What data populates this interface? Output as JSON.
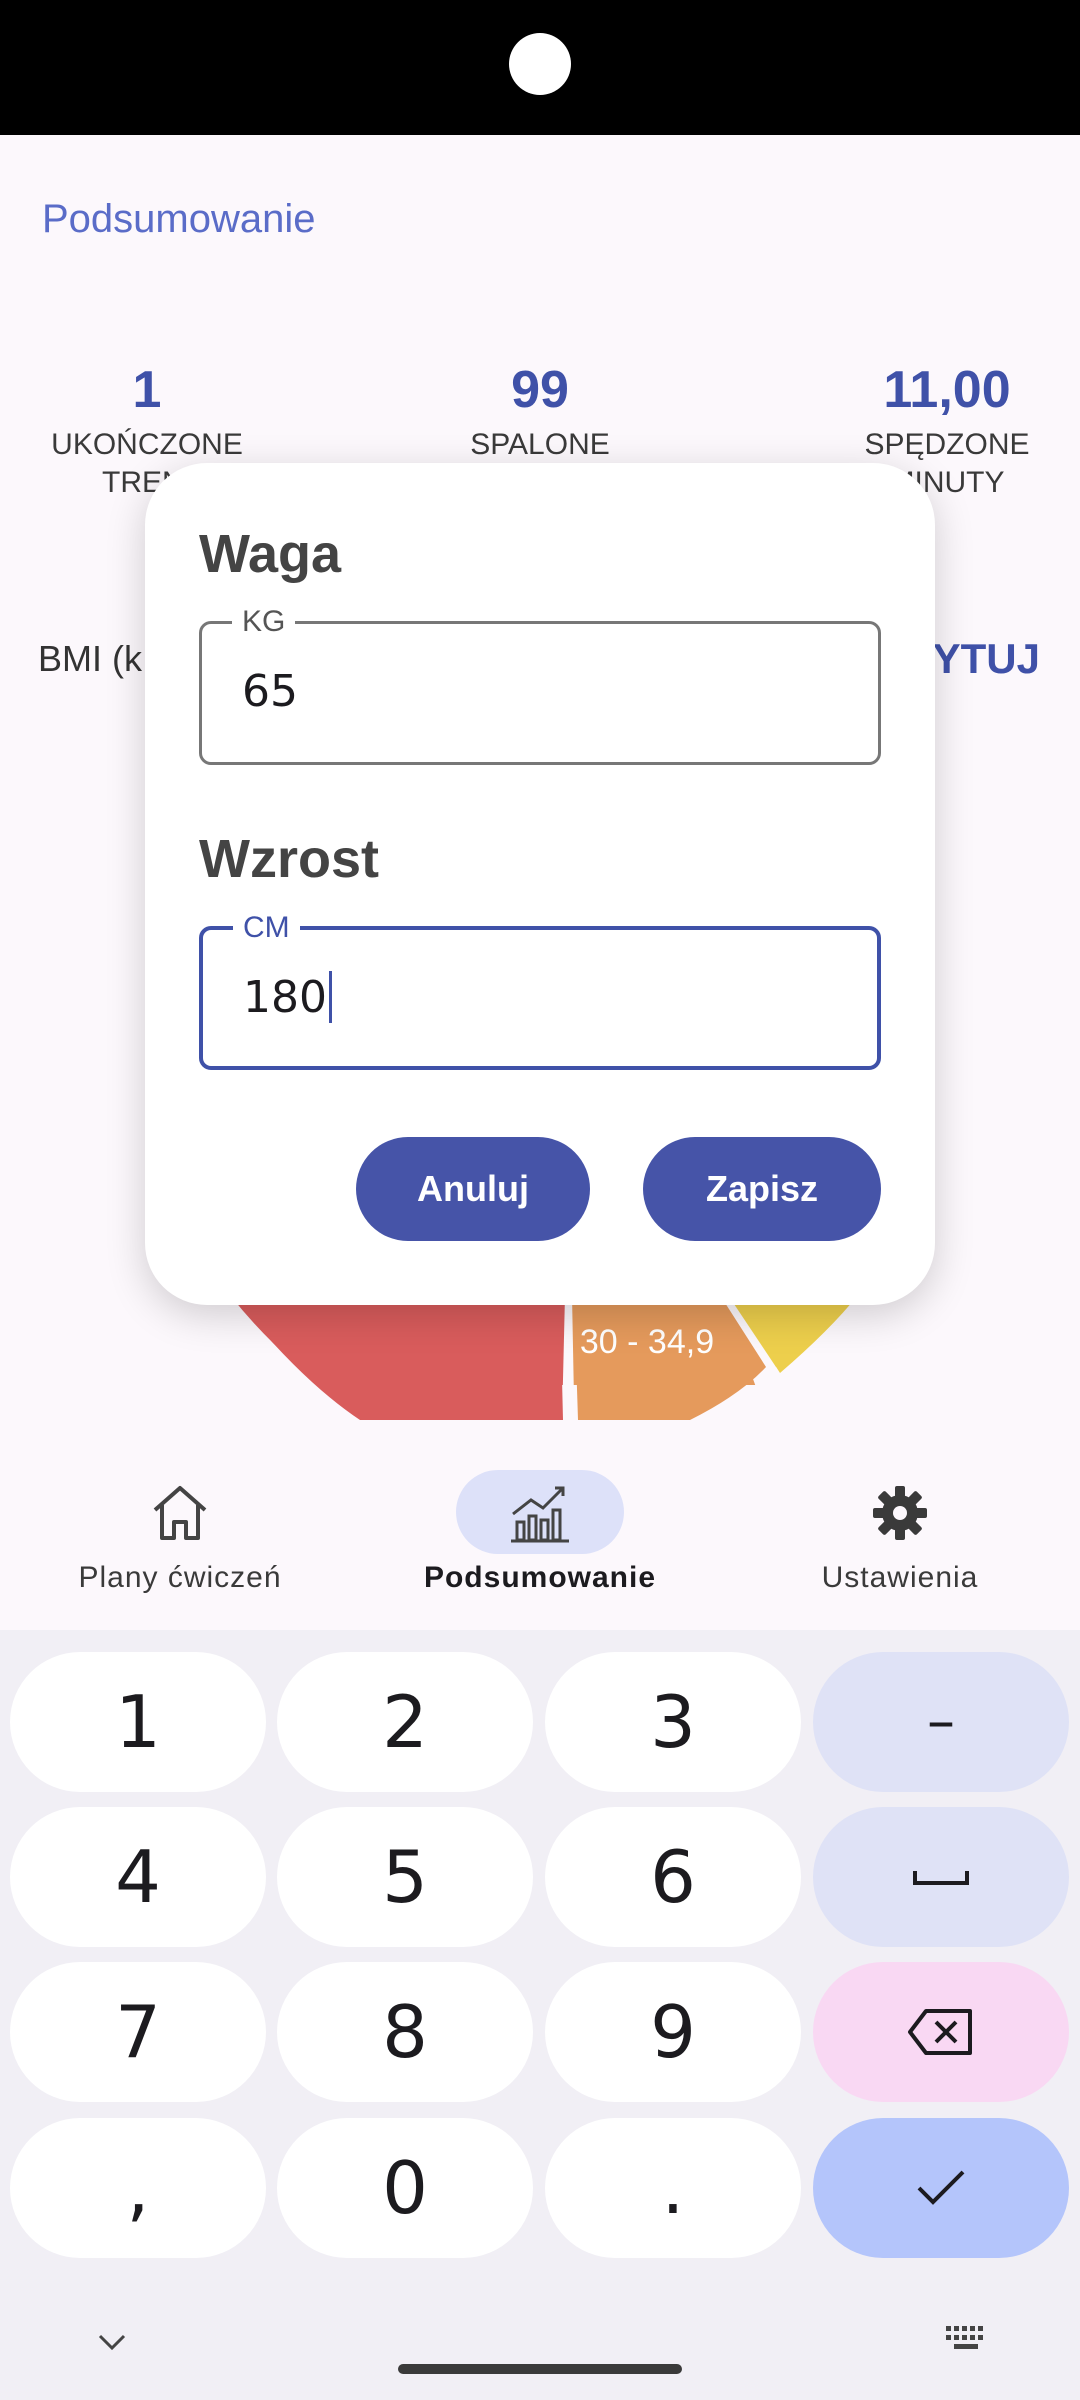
{
  "app": {
    "page_title": "Podsumowanie",
    "stats": [
      {
        "value": "1",
        "label_line1": "UKOŃCZONE",
        "label_line2": "TRENI"
      },
      {
        "value": "99",
        "label_line1": "SPALONE",
        "label_line2": ""
      },
      {
        "value": "11,00",
        "label_line1": "SPĘDZONE",
        "label_line2": "MINUTY"
      }
    ],
    "bmi_label": "BMI (k",
    "edit_link": "YTUJ",
    "chart_segment_label": "30 - 34,9",
    "colors": {
      "accent": "#3f51a8",
      "segment_red": "#d95c5c",
      "segment_orange": "#e59a5c",
      "segment_yellow": "#edcf4c"
    }
  },
  "nav": {
    "items": [
      {
        "label": "Plany ćwiczeń",
        "icon": "home-icon",
        "active": false
      },
      {
        "label": "Podsumowanie",
        "icon": "chart-icon",
        "active": true
      },
      {
        "label": "Ustawienia",
        "icon": "gear-icon",
        "active": false
      }
    ]
  },
  "dialog": {
    "weight": {
      "title": "Waga",
      "unit": "KG",
      "value": "65"
    },
    "height": {
      "title": "Wzrost",
      "unit": "CM",
      "value": "180"
    },
    "cancel_label": "Anuluj",
    "save_label": "Zapisz"
  },
  "keyboard": {
    "rows": [
      [
        "1",
        "2",
        "3",
        "–"
      ],
      [
        "4",
        "5",
        "6",
        "space-icon"
      ],
      [
        "7",
        "8",
        "9",
        "backspace-icon"
      ],
      [
        ",",
        "0",
        ".",
        "check-icon"
      ]
    ]
  }
}
